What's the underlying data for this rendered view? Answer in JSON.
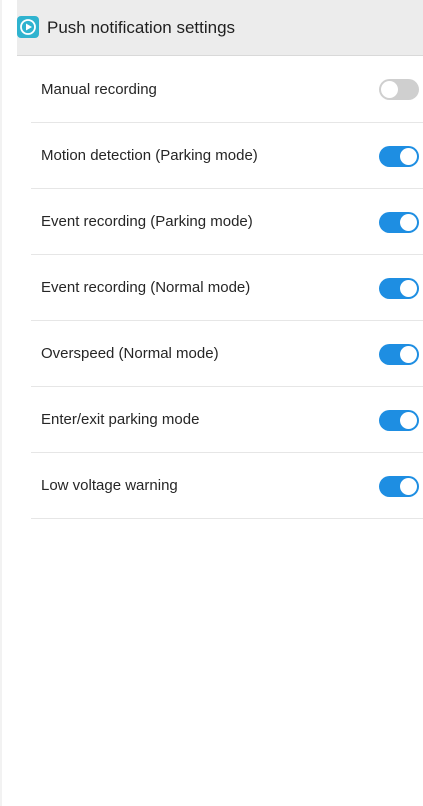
{
  "header": {
    "title": "Push notification settings",
    "icon": "app-logo-icon",
    "background": "#ececec"
  },
  "accent_color": "#1e8ee2",
  "settings": [
    {
      "label": "Manual recording",
      "enabled": false
    },
    {
      "label": "Motion detection (Parking mode)",
      "enabled": true
    },
    {
      "label": "Event recording (Parking mode)",
      "enabled": true
    },
    {
      "label": "Event recording (Normal mode)",
      "enabled": true
    },
    {
      "label": "Overspeed (Normal mode)",
      "enabled": true
    },
    {
      "label": "Enter/exit parking mode",
      "enabled": true
    },
    {
      "label": "Low voltage warning",
      "enabled": true
    }
  ]
}
